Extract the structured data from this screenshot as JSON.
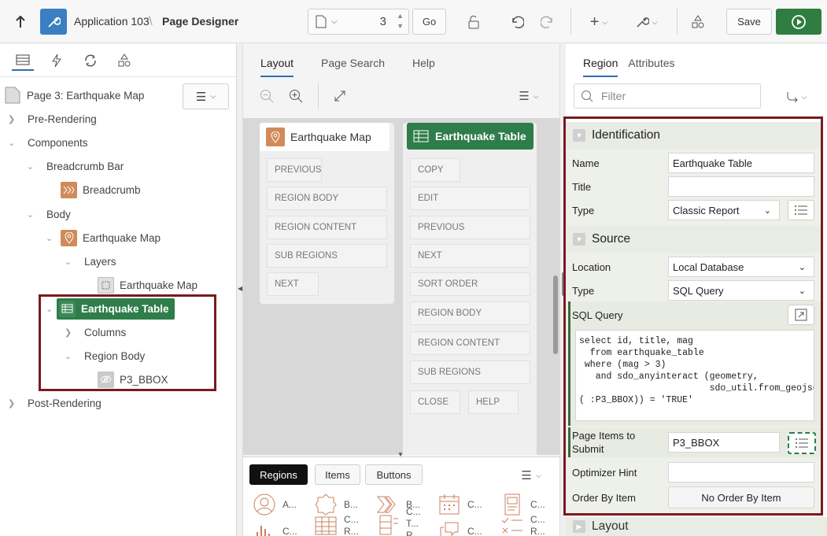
{
  "toolbar": {
    "app_name": "Application 103",
    "page_name": "Page Designer",
    "page_number": "3",
    "go_label": "Go",
    "save_label": "Save"
  },
  "left": {
    "page_title": "Page 3: Earthquake Map",
    "tree": {
      "pre_rendering": "Pre-Rendering",
      "components": "Components",
      "breadcrumb_bar": "Breadcrumb Bar",
      "breadcrumb": "Breadcrumb",
      "body": "Body",
      "earthquake_map": "Earthquake Map",
      "layers": "Layers",
      "layer_map": "Earthquake Map",
      "earthquake_table": "Earthquake Table",
      "columns": "Columns",
      "region_body": "Region Body",
      "p3_bbox": "P3_BBOX",
      "post_rendering": "Post-Rendering"
    }
  },
  "middle": {
    "tabs": [
      "Layout",
      "Page Search",
      "Help"
    ],
    "map_card": {
      "title": "Earthquake Map",
      "slots": [
        "PREVIOUS",
        "REGION BODY",
        "REGION CONTENT",
        "SUB REGIONS",
        "NEXT"
      ]
    },
    "table_card": {
      "title": "Earthquake Table",
      "slots": [
        "COPY",
        "EDIT",
        "PREVIOUS",
        "NEXT",
        "SORT ORDER",
        "REGION BODY",
        "REGION CONTENT",
        "SUB REGIONS",
        "CLOSE",
        "HELP"
      ]
    },
    "gallery_tabs": [
      "Regions",
      "Items",
      "Buttons"
    ],
    "gallery_items": [
      [
        "A..."
      ],
      [
        "B..."
      ],
      [
        "B..."
      ],
      [
        "C..."
      ],
      [
        "C..."
      ],
      [
        "C..."
      ],
      [
        "C...",
        "R..."
      ],
      [
        "C...",
        "T...",
        "R"
      ],
      [
        "C..."
      ],
      [
        "C...",
        "R..."
      ]
    ]
  },
  "right": {
    "tabs": [
      "Region",
      "Attributes"
    ],
    "filter_placeholder": "Filter",
    "identification": {
      "header": "Identification",
      "name_label": "Name",
      "name_value": "Earthquake Table",
      "title_label": "Title",
      "title_value": "",
      "type_label": "Type",
      "type_value": "Classic Report"
    },
    "source": {
      "header": "Source",
      "location_label": "Location",
      "location_value": "Local Database",
      "type_label": "Type",
      "type_value": "SQL Query",
      "sql_label": "SQL Query",
      "sql_lines": [
        "select id, title, mag",
        "  from earthquake_table",
        " where (mag > 3)",
        "   and sdo_anyinteract (geometry,",
        "                        sdo_util.from_geojson",
        "( :P3_BBOX)) = 'TRUE'"
      ],
      "items_submit_label_1": "Page Items to",
      "items_submit_label_2": "Submit",
      "items_submit_value": "P3_BBOX",
      "optimizer_label": "Optimizer Hint",
      "optimizer_value": "",
      "order_by_label": "Order By Item",
      "order_by_value": "No Order By Item"
    },
    "layout_header": "Layout"
  },
  "colors": {
    "accent_blue": "#2d6fb3",
    "green": "#2e7d4a",
    "highlight_border": "#7a1a1f",
    "run_green": "#2f7d41"
  }
}
